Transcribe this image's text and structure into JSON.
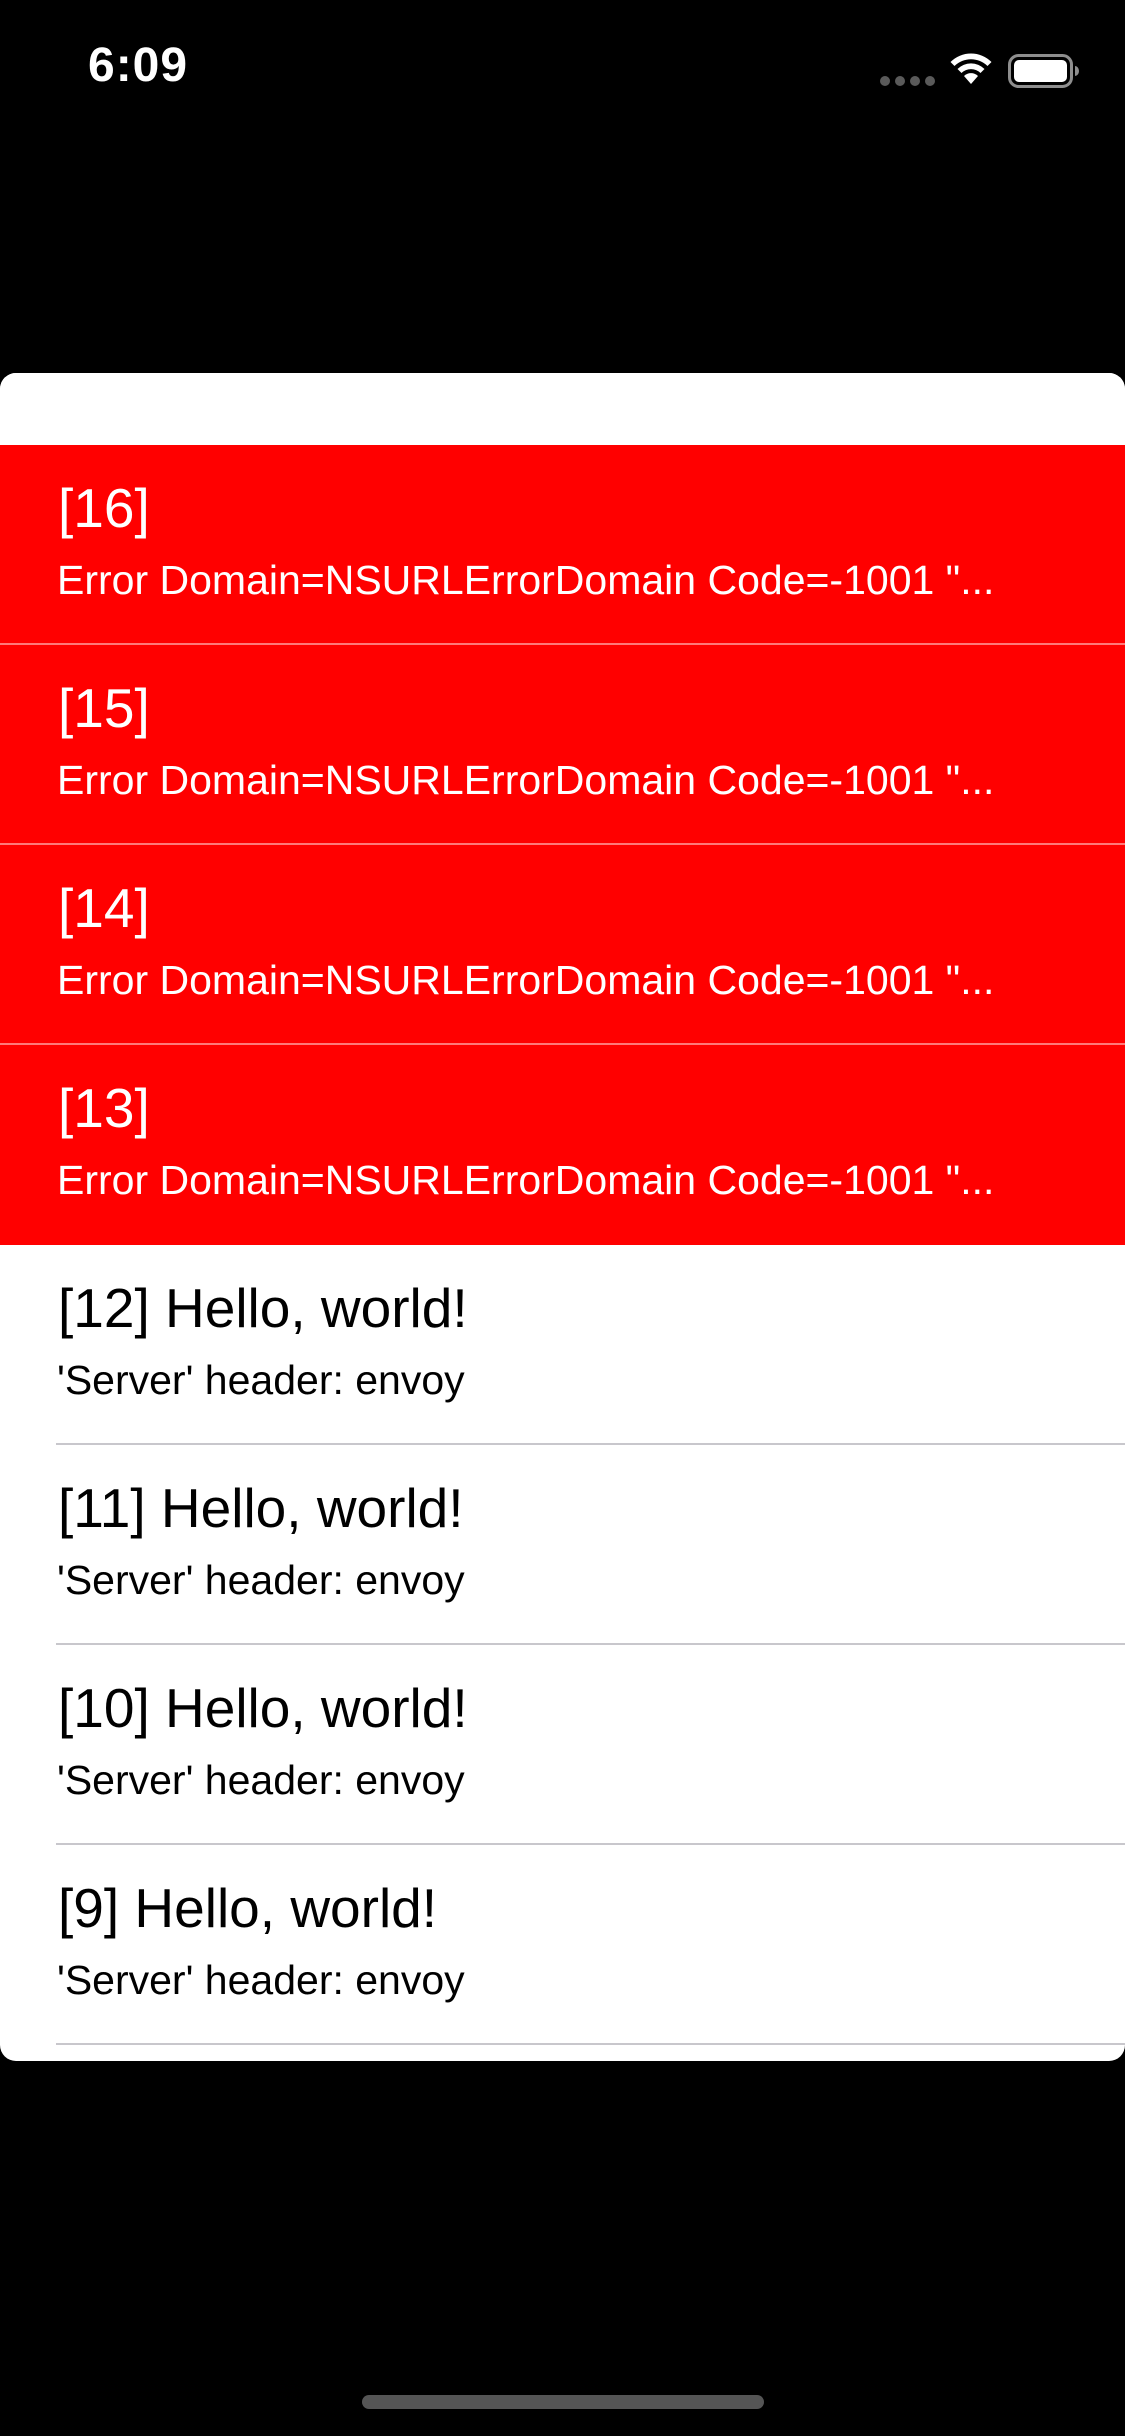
{
  "status_bar": {
    "time": "6:09",
    "icons": [
      "cellular-signal-icon",
      "wifi-icon",
      "battery-icon"
    ]
  },
  "colors": {
    "error_background": "#ff0000",
    "success_background": "#ffffff",
    "screen_background": "#000000"
  },
  "list": {
    "items": [
      {
        "title": "[16]",
        "subtitle": "Error Domain=NSURLErrorDomain Code=-1001 \"...",
        "status": "error"
      },
      {
        "title": "[15]",
        "subtitle": "Error Domain=NSURLErrorDomain Code=-1001 \"...",
        "status": "error"
      },
      {
        "title": "[14]",
        "subtitle": "Error Domain=NSURLErrorDomain Code=-1001 \"...",
        "status": "error"
      },
      {
        "title": "[13]",
        "subtitle": "Error Domain=NSURLErrorDomain Code=-1001 \"...",
        "status": "error"
      },
      {
        "title": "[12] Hello, world!",
        "subtitle": "'Server' header: envoy",
        "status": "ok"
      },
      {
        "title": "[11] Hello, world!",
        "subtitle": "'Server' header: envoy",
        "status": "ok"
      },
      {
        "title": "[10] Hello, world!",
        "subtitle": "'Server' header: envoy",
        "status": "ok"
      },
      {
        "title": "[9] Hello, world!",
        "subtitle": "'Server' header: envoy",
        "status": "ok"
      }
    ]
  }
}
